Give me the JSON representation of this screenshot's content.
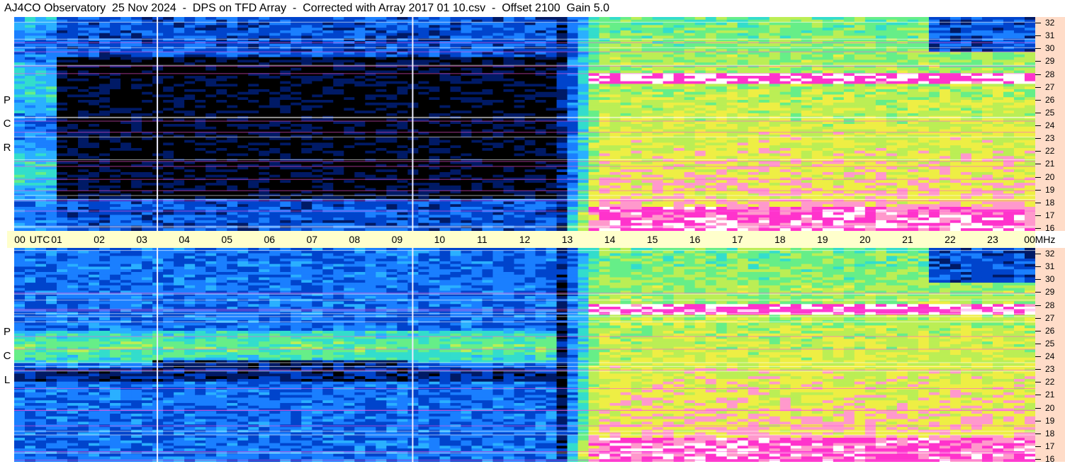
{
  "title": "AJ4CO Observatory  25 Nov 2024  -  DPS on TFD Array  -  Corrected with Array 2017 01 10.csv  -  Offset 2100  Gain 5.0",
  "labels": {
    "rcp": [
      "P",
      "C",
      "R"
    ],
    "lcp": [
      "P",
      "C",
      "L"
    ],
    "utc": "UTC",
    "mhz": "MHz"
  },
  "chart_data": {
    "type": "heatmap",
    "title": "AJ4CO Observatory  25 Nov 2024  -  DPS on TFD Array  -  Corrected with Array 2017 01 10.csv  -  Offset 2100  Gain 5.0",
    "x_ticks": [
      "00",
      "01",
      "02",
      "03",
      "04",
      "05",
      "06",
      "07",
      "08",
      "09",
      "10",
      "11",
      "12",
      "13",
      "14",
      "15",
      "16",
      "17",
      "18",
      "19",
      "20",
      "21",
      "22",
      "23",
      "00"
    ],
    "y_ticks": [
      "16",
      "17",
      "18",
      "19",
      "20",
      "21",
      "22",
      "23",
      "24",
      "25",
      "26",
      "27",
      "28",
      "29",
      "30",
      "31",
      "32"
    ],
    "xlabel": "UTC",
    "ylabel": "MHz",
    "xlim": [
      0,
      24
    ],
    "ylim": [
      16,
      32
    ],
    "panels": [
      "RCP",
      "LCP"
    ],
    "vertical_markers_utc": [
      3.35,
      9.35
    ],
    "colormap": [
      "#000000",
      "#001a66",
      "#0044cc",
      "#1a7fff",
      "#2ab0ff",
      "#33ddcc",
      "#66ee88",
      "#bbee55",
      "#eeee44",
      "#ff99cc",
      "#ff33cc",
      "#ffffff"
    ]
  },
  "colors": {
    "time_axis_bg": "#ffffcc",
    "freq_axis_bg": "#ffdcc8"
  }
}
